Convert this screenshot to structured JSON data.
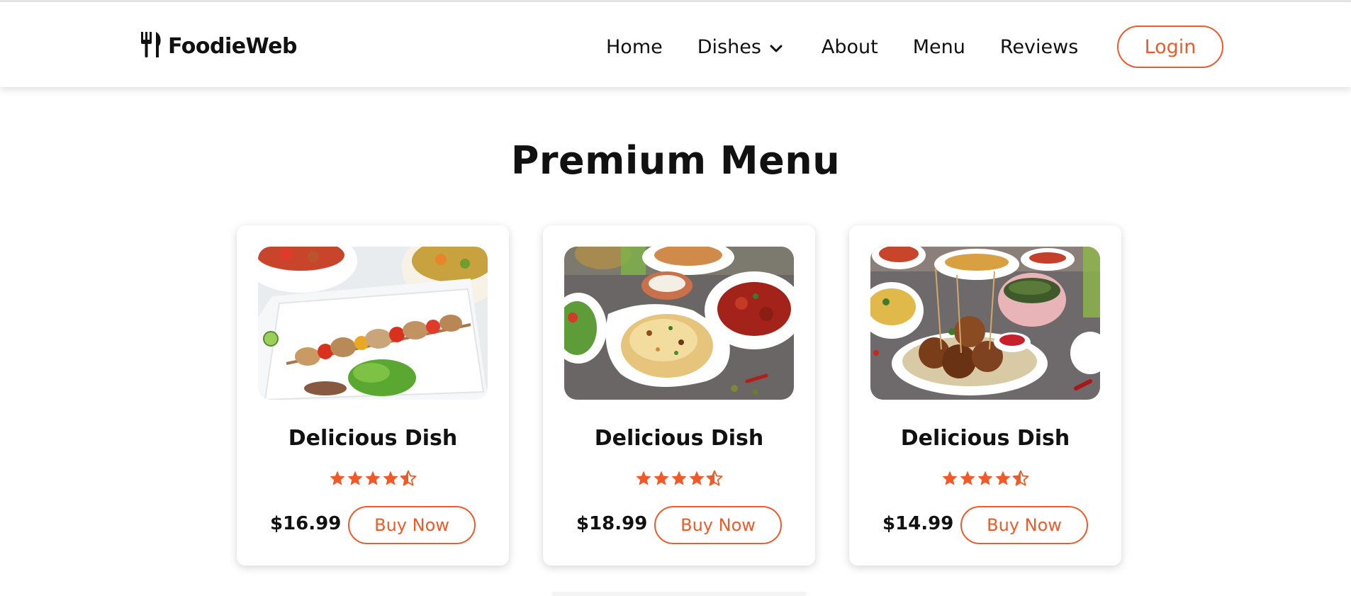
{
  "brand": {
    "name": "FoodieWeb",
    "icon": "fork-knife-icon"
  },
  "nav": {
    "home": "Home",
    "dishes": "Dishes",
    "about": "About",
    "menu": "Menu",
    "reviews": "Reviews",
    "login": "Login"
  },
  "page": {
    "title": "Premium Menu"
  },
  "colors": {
    "accent": "#f05a28",
    "text": "#111111",
    "background": "#ffffff"
  },
  "cards": [
    {
      "title": "Delicious Dish",
      "price": "$16.99",
      "button": "Buy Now",
      "rating": 4.5,
      "image": "chicken-skewers-photo"
    },
    {
      "title": "Delicious Dish",
      "price": "$18.99",
      "button": "Buy Now",
      "rating": 4.5,
      "image": "biryani-photo"
    },
    {
      "title": "Delicious Dish",
      "price": "$14.99",
      "button": "Buy Now",
      "rating": 4.5,
      "image": "kofta-balls-photo"
    }
  ]
}
